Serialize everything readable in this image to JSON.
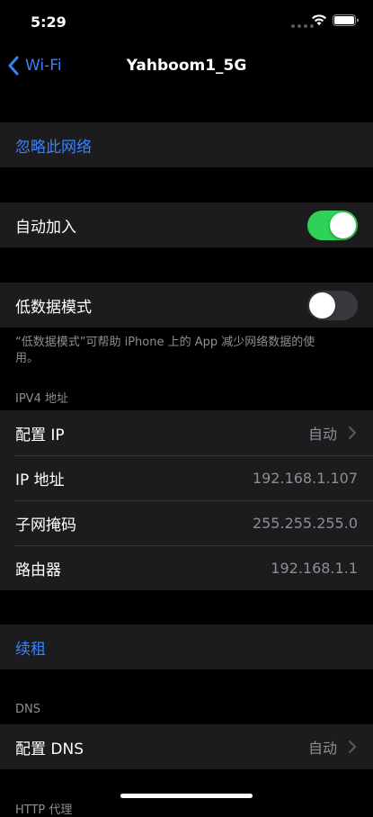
{
  "status_bar": {
    "time": "5:29"
  },
  "nav": {
    "back_label": "Wi-Fi",
    "title": "Yahboom1_5G"
  },
  "forget": {
    "label": "忽略此网络"
  },
  "auto_join": {
    "label": "自动加入",
    "enabled": true
  },
  "low_data": {
    "label": "低数据模式",
    "enabled": false,
    "footnote": "“低数据模式”可帮助 iPhone 上的 App 减少网络数据的使用。"
  },
  "ipv4": {
    "header": "IPV4 地址",
    "rows": [
      {
        "label": "配置 IP",
        "value": "自动"
      },
      {
        "label": "IP 地址",
        "value": "192.168.1.107"
      },
      {
        "label": "子网掩码",
        "value": "255.255.255.0"
      },
      {
        "label": "路由器",
        "value": "192.168.1.1"
      }
    ]
  },
  "renew": {
    "label": "续租"
  },
  "dns": {
    "header": "DNS",
    "rows": [
      {
        "label": "配置 DNS",
        "value": "自动"
      }
    ]
  },
  "proxy": {
    "header": "HTTP 代理"
  },
  "colors": {
    "accent": "#3a82f7",
    "toggle_on": "#30d158"
  }
}
